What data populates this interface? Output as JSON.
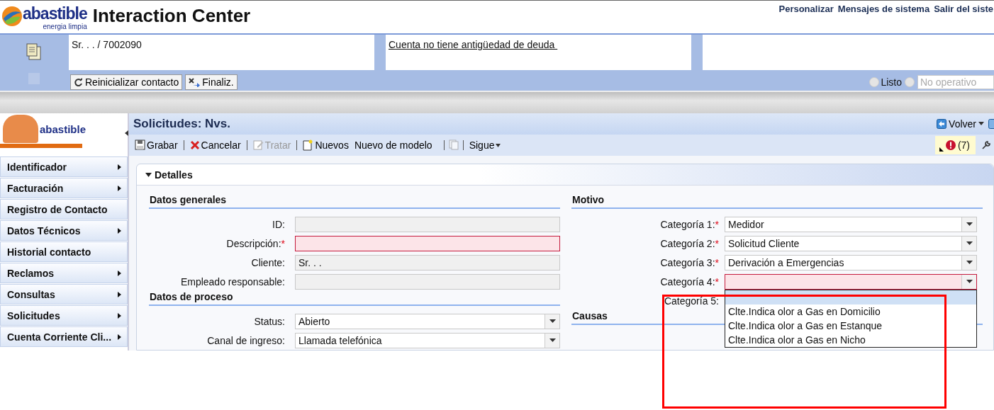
{
  "header": {
    "brand": "abastible",
    "tagline": "energia limpia",
    "title": "Interaction Center",
    "links": [
      "Personalizar",
      "Mensajes de sistema",
      "Salir del siste"
    ]
  },
  "contact_bar": {
    "account": "Sr. . . / 7002090",
    "notice": "Cuenta no tiene antigüedad de deuda ",
    "buttons": [
      {
        "label": "Reinicializar contacto"
      },
      {
        "label": "Finaliz."
      }
    ],
    "status_options": [
      {
        "label": "Listo",
        "selected": false
      },
      {
        "selected": false
      }
    ],
    "status_field": {
      "placeholder": "No operativo"
    }
  },
  "sidebar": {
    "logo_text": "abastible",
    "items": [
      {
        "label": "Identificador",
        "has_submenu": true
      },
      {
        "label": "Facturación",
        "has_submenu": true
      },
      {
        "label": "Registro de Contacto",
        "has_submenu": false
      },
      {
        "label": "Datos Técnicos",
        "has_submenu": true
      },
      {
        "label": "Historial contacto",
        "has_submenu": false
      },
      {
        "label": "Reclamos",
        "has_submenu": true
      },
      {
        "label": "Consultas",
        "has_submenu": true
      },
      {
        "label": "Solicitudes",
        "has_submenu": true
      },
      {
        "label": "Cuenta Corriente Cli...",
        "has_submenu": true
      }
    ]
  },
  "page": {
    "title": "Solicitudes: Nvs.",
    "back": "Volver",
    "alerts": "(7)",
    "toolbar": [
      {
        "kind": "button",
        "label": "Grabar",
        "disabled": false
      },
      {
        "kind": "button",
        "label": "Cancelar",
        "disabled": false
      },
      {
        "kind": "button",
        "label": "Tratar",
        "disabled": true
      },
      {
        "kind": "button",
        "label": "Nuevos",
        "disabled": false
      },
      {
        "kind": "button",
        "label": "Nuevo de modelo",
        "disabled": false
      },
      {
        "kind": "icon",
        "disabled": true
      },
      {
        "kind": "menu",
        "label": "Sigue",
        "disabled": false
      }
    ]
  },
  "panel": {
    "title": "Detalles",
    "expanded": true,
    "left": [
      {
        "title": "Datos generales",
        "fields": [
          {
            "label": "ID:",
            "kind": "readonly",
            "required": false
          },
          {
            "label": "Descripción:",
            "kind": "input",
            "required": true,
            "required_mark": "*"
          },
          {
            "label": "Cliente:",
            "kind": "readonly",
            "required": false,
            "value": "Sr. . ."
          },
          {
            "label": "Empleado responsable:",
            "kind": "readonly",
            "required": false
          }
        ]
      },
      {
        "title": "Datos de proceso",
        "fields": [
          {
            "label": "Status:",
            "kind": "select",
            "required": false,
            "value": "Abierto"
          },
          {
            "label": "Canal de ingreso:",
            "kind": "select",
            "required": false,
            "value": "Llamada telefónica"
          }
        ]
      }
    ],
    "right": [
      {
        "title": "Motivo",
        "fields": [
          {
            "label": "Categoría 1:",
            "kind": "select",
            "required": true,
            "required_mark": "*",
            "value": "Medidor"
          },
          {
            "label": "Categoría 2:",
            "kind": "select",
            "required": true,
            "required_mark": "*",
            "value": "Solicitud Cliente"
          },
          {
            "label": "Categoría 3:",
            "kind": "select",
            "required": true,
            "required_mark": "*",
            "value": "Derivación a Emergencias"
          },
          {
            "label": "Categoría 4:",
            "kind": "select",
            "required": true,
            "required_mark": "*",
            "expanded": true,
            "blank_selected": true,
            "options": [
              {
                "label": "Clte.Indica olor a Gas en Domicilio",
                "selected": false
              },
              {
                "label": "Clte.Indica olor a Gas en Estanque",
                "selected": false
              },
              {
                "label": "Clte.Indica olor a Gas en Nicho",
                "selected": false
              }
            ]
          },
          {
            "label": "Categoría 5:",
            "kind": "hidden",
            "required": false
          }
        ]
      },
      {
        "title": "Causas"
      }
    ]
  },
  "annotation": {
    "kind": "highlight-rectangle"
  }
}
